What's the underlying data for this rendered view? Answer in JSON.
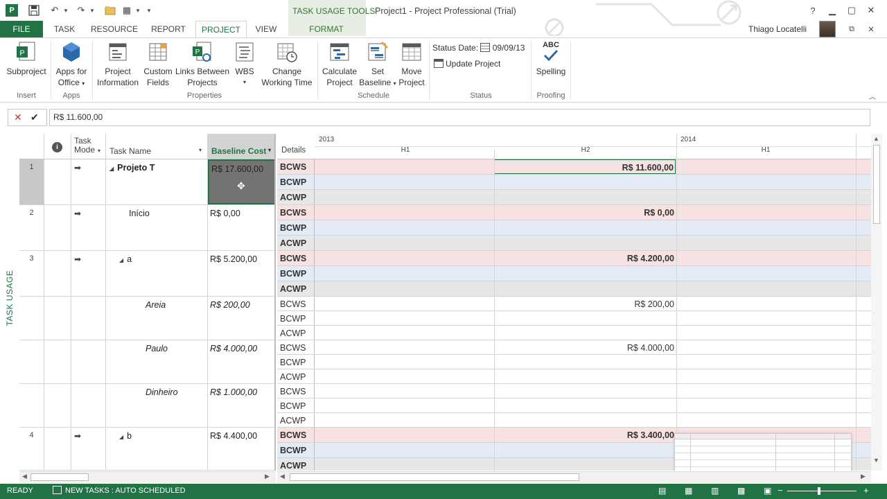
{
  "window": {
    "title": "Project1 - Project Professional (Trial)",
    "contextual_tab": "TASK USAGE TOOLS",
    "user": "Thiago Locatelli"
  },
  "tabs": [
    "FILE",
    "TASK",
    "RESOURCE",
    "REPORT",
    "PROJECT",
    "VIEW",
    "FORMAT"
  ],
  "ribbon": {
    "subproject": "Subproject",
    "apps_line1": "Apps for",
    "apps_line2": "Office",
    "projinfo_line1": "Project",
    "projinfo_line2": "Information",
    "custom_line1": "Custom",
    "custom_line2": "Fields",
    "links_line1": "Links Between",
    "links_line2": "Projects",
    "wbs": "WBS",
    "change_line1": "Change",
    "change_line2": "Working Time",
    "calc_line1": "Calculate",
    "calc_line2": "Project",
    "setbase_line1": "Set",
    "setbase_line2": "Baseline",
    "move_line1": "Move",
    "move_line2": "Project",
    "status_date_label": "Status Date:",
    "status_date_value": "09/09/13",
    "update_project": "Update Project",
    "spelling": "Spelling",
    "spelling_icon_text": "ABC",
    "groups": {
      "insert": "Insert",
      "apps": "Apps",
      "properties": "Properties",
      "schedule": "Schedule",
      "status": "Status",
      "proofing": "Proofing"
    }
  },
  "formula_bar": {
    "value": "R$ 11.600,00"
  },
  "view_label": "TASK USAGE",
  "grid": {
    "headers": {
      "task_mode": "Task Mode",
      "task_name": "Task Name",
      "baseline_cost": "Baseline Cost"
    },
    "rows": [
      {
        "id": "1",
        "name": "Projeto T",
        "cost": "R$ 17.600,00"
      },
      {
        "id": "2",
        "name": "Início",
        "cost": "R$ 0,00"
      },
      {
        "id": "3",
        "name": "a",
        "cost": "R$ 5.200,00"
      },
      {
        "id": "",
        "name": "Areia",
        "cost": "R$ 200,00"
      },
      {
        "id": "",
        "name": "Paulo",
        "cost": "R$ 4.000,00"
      },
      {
        "id": "",
        "name": "Dinheiro",
        "cost": "R$ 1.000,00"
      },
      {
        "id": "4",
        "name": "b",
        "cost": "R$ 4.400,00"
      }
    ]
  },
  "timescale": {
    "details_label": "Details",
    "year1": "2013",
    "year2": "2014",
    "h1": "H1",
    "h2": "H2",
    "h1b": "H1"
  },
  "timephased": {
    "labels": [
      "BCWS",
      "BCWP",
      "ACWP"
    ],
    "h2_values": [
      "R$ 11.600,00",
      "",
      "",
      "R$ 0,00",
      "",
      "",
      "R$ 4.200,00",
      "",
      "",
      "R$ 200,00",
      "",
      "",
      "R$ 4.000,00",
      "",
      "",
      "",
      "",
      "",
      "R$ 3.400,00",
      "",
      ""
    ]
  },
  "status_bar": {
    "ready": "READY",
    "new_tasks": "NEW TASKS : AUTO SCHEDULED"
  }
}
